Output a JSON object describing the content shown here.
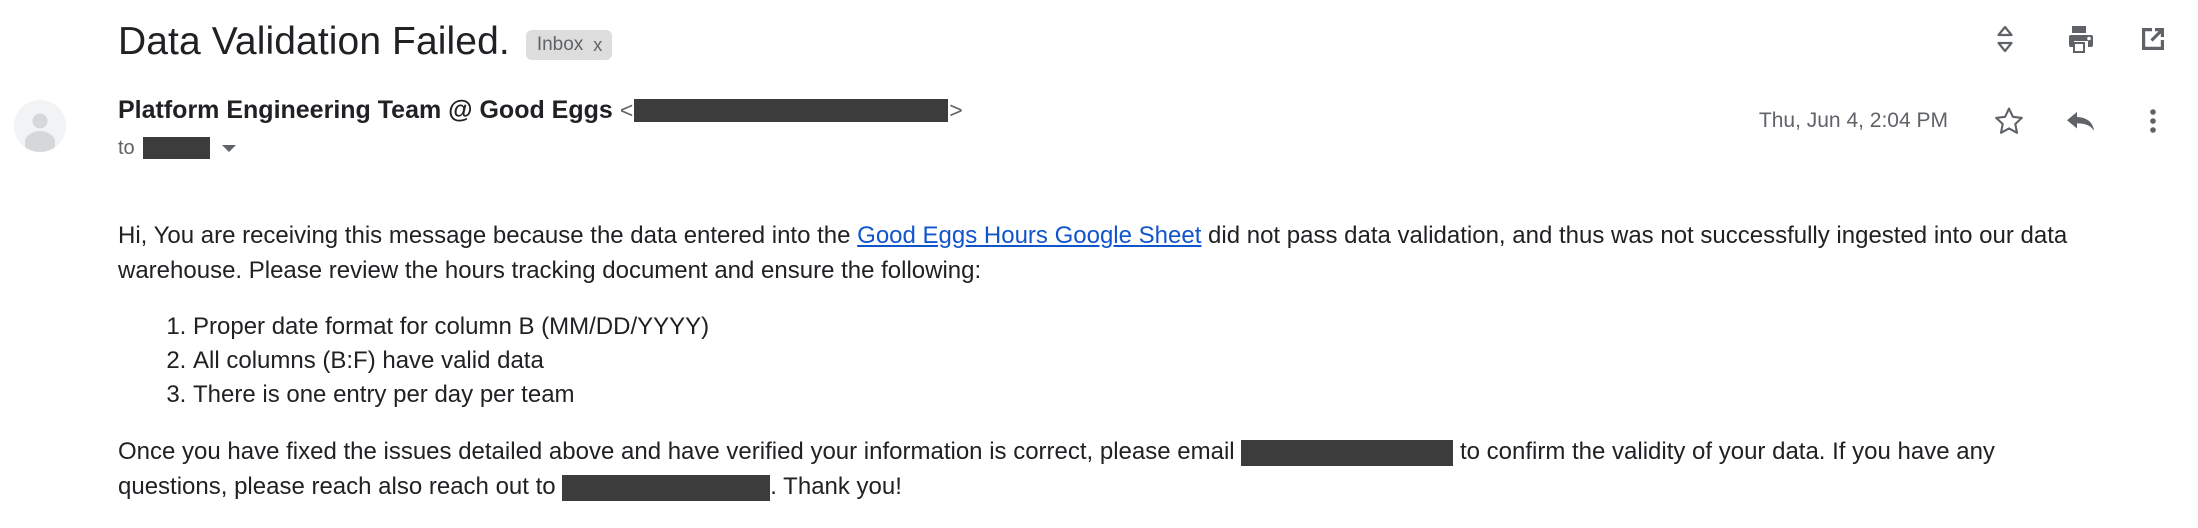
{
  "email": {
    "subject": "Data Validation Failed.",
    "label": {
      "name": "Inbox",
      "remove": "x"
    },
    "header_actions": [
      {
        "icon": "expand-collapse-icon",
        "title": "Collapse all"
      },
      {
        "icon": "print-icon",
        "title": "Print all"
      },
      {
        "icon": "open-in-new-icon",
        "title": "Open in new window"
      }
    ],
    "sender": {
      "name": "Platform Engineering Team @ Good Eggs",
      "angle_open": "<",
      "angle_close": ">",
      "address_redacted": true
    },
    "recipient": {
      "to_label": "to",
      "address_redacted": true,
      "details_caret": "chevron-down-icon"
    },
    "timestamp": "Thu, Jun 4, 2:04 PM",
    "message_actions": [
      {
        "icon": "star-icon",
        "title": "Star"
      },
      {
        "icon": "reply-icon",
        "title": "Reply"
      },
      {
        "icon": "more-vertical-icon",
        "title": "More"
      }
    ],
    "body": {
      "intro_before_link": "Hi, You are receiving this message because the data entered into the ",
      "link_text": "Good Eggs Hours Google Sheet",
      "intro_after_link": " did not pass data validation, and thus was not successfully ingested into our data warehouse. Please review the hours tracking document and ensure the following:",
      "checklist": [
        "Proper date format for column B (MM/DD/YYYY)",
        "All columns (B:F) have valid data",
        "There is one entry per day per team"
      ],
      "closing_part1": "Once you have fixed the issues detailed above and have verified your information is correct, please email ",
      "closing_part2": " to confirm the validity of your data. If you have any questions, please reach also reach out to ",
      "closing_part3": ". Thank you!"
    }
  },
  "colors": {
    "link": "#1155cc",
    "redaction": "#3c3c3c",
    "chip_background": "#dddddd",
    "secondary_text": "#5f6368",
    "primary_text": "#202124"
  }
}
